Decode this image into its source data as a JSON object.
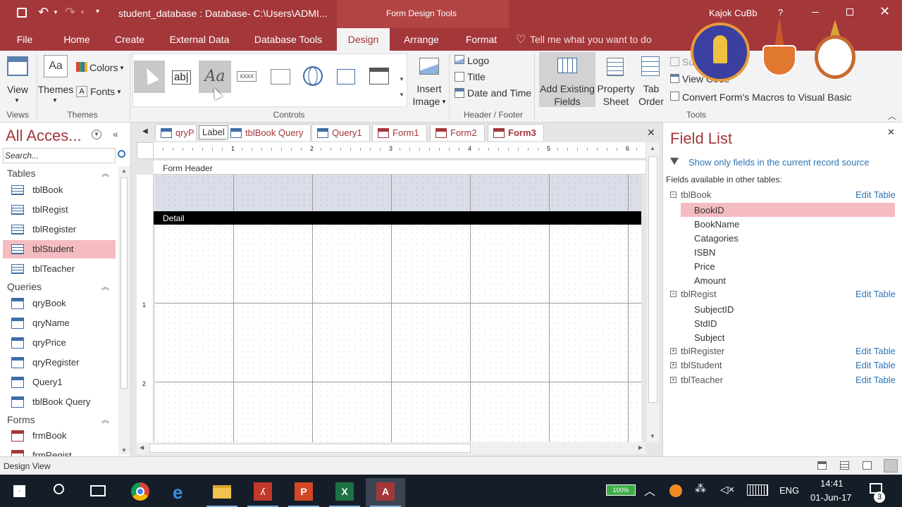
{
  "titlebar": {
    "title": "student_database : Database- C:\\Users\\ADMI...",
    "context_tools": "Form Design Tools",
    "user": "Kajok CuBb",
    "help": "?"
  },
  "ribbon_tabs": [
    "File",
    "Home",
    "Create",
    "External Data",
    "Database Tools",
    "Design",
    "Arrange",
    "Format"
  ],
  "tell_me": "Tell me what you want to do",
  "ribbon": {
    "views": {
      "view_label": "View",
      "group": "Views"
    },
    "themes": {
      "themes_label": "Themes",
      "colors_label": "Colors",
      "fonts_label": "Fonts",
      "group": "Themes"
    },
    "controls": {
      "group": "Controls",
      "textbox": "ab|",
      "label": "Aa",
      "xxxx": "xxxx",
      "insert_image": "Insert",
      "insert_image2": "Image"
    },
    "header_footer": {
      "logo": "Logo",
      "title": "Title",
      "date_time": "Date and Time",
      "group": "Header / Footer"
    },
    "tools": {
      "add_existing": "Add Existing",
      "add_existing2": "Fields",
      "property": "Property",
      "property2": "Sheet",
      "tab": "Tab",
      "tab2": "Order",
      "sub": "Su",
      "view_code": "View Code",
      "convert": "Convert Form's Macros to Visual Basic",
      "group": "Tools"
    }
  },
  "nav": {
    "title": "All Acces...",
    "search_placeholder": "Search...",
    "sections": [
      {
        "name": "Tables",
        "items": [
          "tblBook",
          "tblRegist",
          "tblRegister",
          "tblStudent",
          "tblTeacher"
        ]
      },
      {
        "name": "Queries",
        "items": [
          "qryBook",
          "qryName",
          "qryPrice",
          "qryRegister",
          "Query1",
          "tblBook Query"
        ]
      },
      {
        "name": "Forms",
        "items": [
          "frmBook",
          "frmRegist"
        ]
      }
    ],
    "selected": "tblStudent"
  },
  "doc_tabs": [
    "qryP",
    "tblBook Query",
    "Query1",
    "Form1",
    "Form2",
    "Form3"
  ],
  "tooltip": "Label",
  "form": {
    "header_label": "Form Header",
    "detail_label": "Detail",
    "ruler": [
      "1",
      "2",
      "3",
      "4",
      "5",
      "6"
    ],
    "vruler": [
      "1",
      "2"
    ]
  },
  "field_list": {
    "title": "Field List",
    "show_only": "Show only fields in the current record source",
    "other_tables": "Fields available in other tables:",
    "edit_table": "Edit Table",
    "tables": [
      {
        "name": "tblBook",
        "expanded": true,
        "fields": [
          "BookID",
          "BookName",
          "Catagories",
          "ISBN",
          "Price",
          "Amount"
        ]
      },
      {
        "name": "tblRegist",
        "expanded": true,
        "fields": [
          "SubjectID",
          "StdID",
          "Subject"
        ]
      },
      {
        "name": "tblRegister",
        "expanded": false,
        "fields": []
      },
      {
        "name": "tblStudent",
        "expanded": false,
        "fields": []
      },
      {
        "name": "tblTeacher",
        "expanded": false,
        "fields": []
      }
    ],
    "selected_field": "BookID"
  },
  "status": {
    "text": "Design View"
  },
  "taskbar": {
    "lang": "ENG",
    "time": "14:41",
    "date": "01-Jun-17",
    "battery": "100%",
    "notif": "3"
  },
  "colors": {
    "accent": "#a4373a",
    "selection": "#f4bcc1",
    "link": "#2e75b6"
  }
}
